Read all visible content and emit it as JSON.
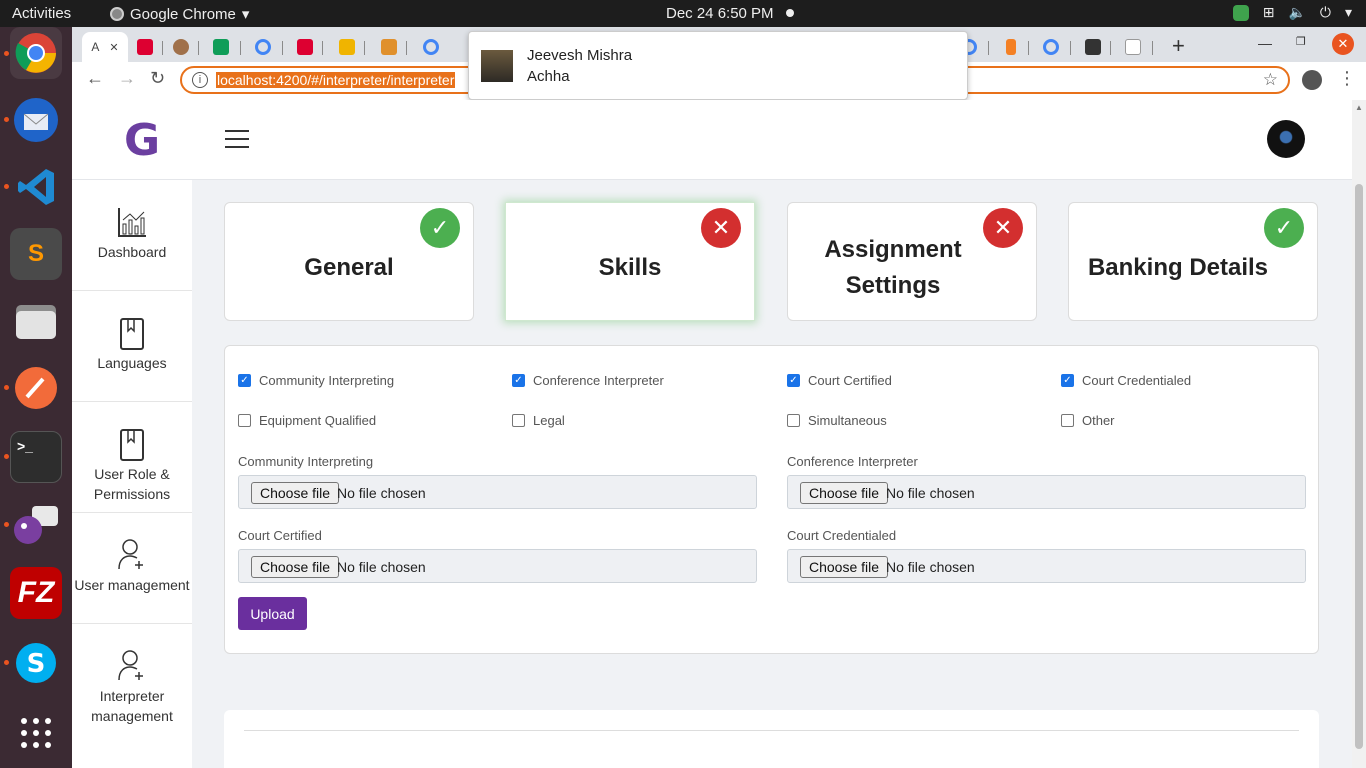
{
  "os_topbar": {
    "activities": "Activities",
    "app_name": "Google Chrome",
    "clock": "Dec 24  6:50 PM"
  },
  "browser": {
    "active_tab_label": "A",
    "url": "localhost:4200/#/interpreter/interpreter",
    "new_tab": "+"
  },
  "notification": {
    "sender": "Jeevesh Mishra",
    "message": "Achha"
  },
  "app": {
    "logo_letter": "G"
  },
  "sidebar": {
    "items": [
      {
        "label": "Dashboard",
        "icon": "chart-icon"
      },
      {
        "label": "Languages",
        "icon": "book-icon"
      },
      {
        "label": "User Role & Permissions",
        "icon": "book-icon"
      },
      {
        "label": "User management",
        "icon": "add-user-icon"
      },
      {
        "label": "Interpreter management",
        "icon": "add-user-icon"
      }
    ]
  },
  "steps": [
    {
      "title": "General",
      "status": "complete"
    },
    {
      "title": "Skills",
      "status": "incomplete"
    },
    {
      "title": "Assignment Settings",
      "status": "incomplete"
    },
    {
      "title": "Banking Details",
      "status": "complete"
    }
  ],
  "skills": {
    "options": [
      {
        "label": "Community Interpreting",
        "checked": true
      },
      {
        "label": "Conference Interpreter",
        "checked": true
      },
      {
        "label": "Court Certified",
        "checked": true
      },
      {
        "label": "Court Credentialed",
        "checked": true
      },
      {
        "label": "Equipment Qualified",
        "checked": false
      },
      {
        "label": "Legal",
        "checked": false
      },
      {
        "label": "Simultaneous",
        "checked": false
      },
      {
        "label": "Other",
        "checked": false
      }
    ],
    "uploads": [
      {
        "label": "Community Interpreting",
        "button": "Choose file",
        "status": "No file chosen"
      },
      {
        "label": "Conference Interpreter",
        "button": "Choose file",
        "status": "No file chosen"
      },
      {
        "label": "Court Certified",
        "button": "Choose file",
        "status": "No file chosen"
      },
      {
        "label": "Court Credentialed",
        "button": "Choose file",
        "status": "No file chosen"
      }
    ],
    "upload_button": "Upload"
  },
  "colors": {
    "accent_purple": "#6a2f9e",
    "success_green": "#4caf50",
    "error_red": "#d32f2f",
    "omnibox_orange": "#e8711a"
  }
}
